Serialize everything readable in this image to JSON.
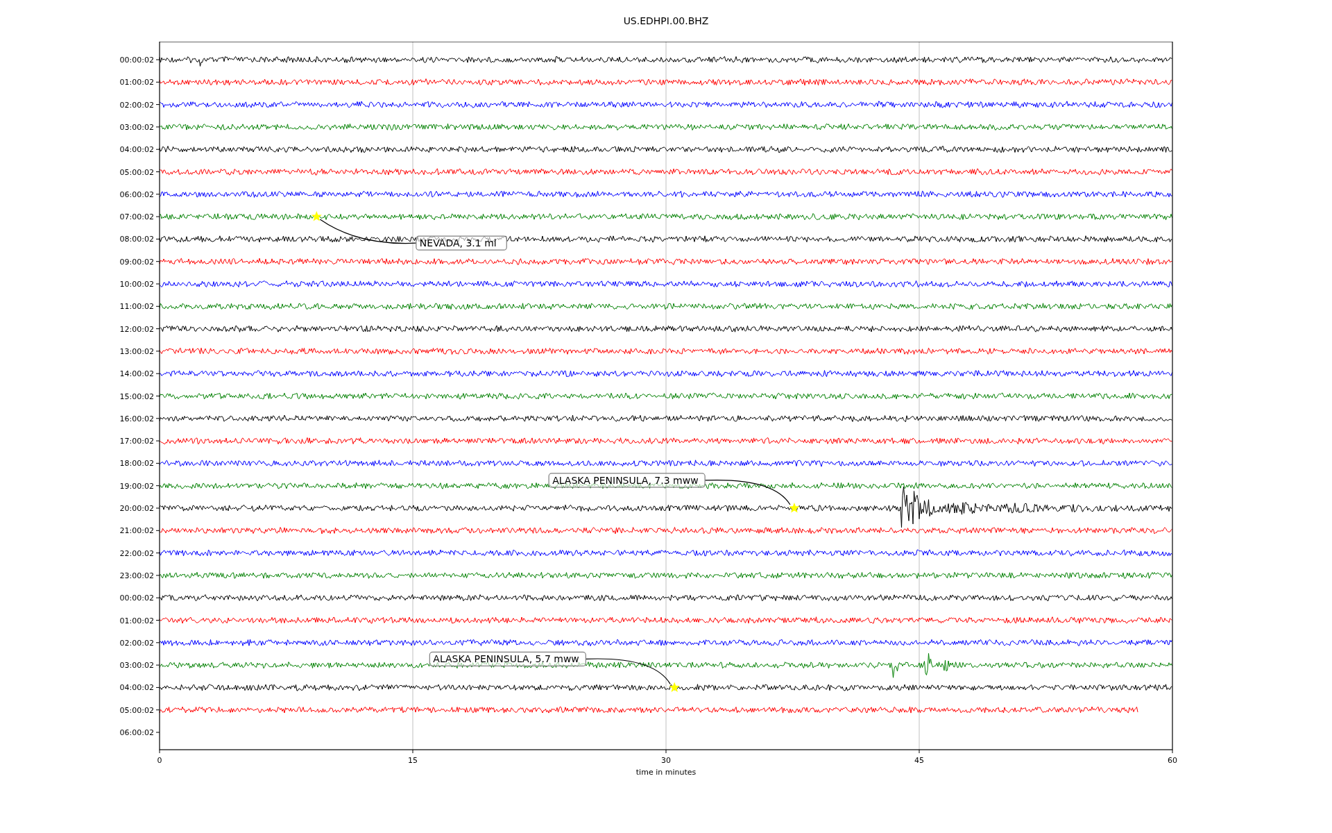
{
  "title": "US.EDHPI.00.BHZ",
  "rows": [
    {
      "label": "00:00:02",
      "kind": "full",
      "color": "#000000"
    },
    {
      "label": "01:00:02",
      "kind": "full",
      "color": "#ff0000"
    },
    {
      "label": "02:00:02",
      "kind": "full",
      "color": "#0000ff"
    },
    {
      "label": "03:00:02",
      "kind": "full",
      "color": "#008000"
    },
    {
      "label": "04:00:02",
      "kind": "full",
      "color": "#000000"
    },
    {
      "label": "05:00:02",
      "kind": "full",
      "color": "#ff0000"
    },
    {
      "label": "06:00:02",
      "kind": "full",
      "color": "#0000ff"
    },
    {
      "label": "07:00:02",
      "kind": "full",
      "color": "#008000",
      "event": {
        "label": "NEVADA, 3.1 ml"
      }
    },
    {
      "label": "08:00:02",
      "kind": "full",
      "color": "#000000"
    },
    {
      "label": "09:00:02",
      "kind": "full",
      "color": "#ff0000"
    },
    {
      "label": "10:00:02",
      "kind": "full",
      "color": "#0000ff"
    },
    {
      "label": "11:00:02",
      "kind": "full",
      "color": "#008000"
    },
    {
      "label": "12:00:02",
      "kind": "full",
      "color": "#000000"
    },
    {
      "label": "13:00:02",
      "kind": "full",
      "color": "#ff0000"
    },
    {
      "label": "14:00:02",
      "kind": "full",
      "color": "#0000ff"
    },
    {
      "label": "15:00:02",
      "kind": "full",
      "color": "#008000"
    },
    {
      "label": "16:00:02",
      "kind": "full",
      "color": "#000000"
    },
    {
      "label": "17:00:02",
      "kind": "full",
      "color": "#ff0000"
    },
    {
      "label": "18:00:02",
      "kind": "full",
      "color": "#0000ff"
    },
    {
      "label": "19:00:02",
      "kind": "full",
      "color": "#008000"
    },
    {
      "label": "20:00:02",
      "kind": "full",
      "color": "#000000",
      "event": {
        "label": "ALASKA PENINSULA, 7.3 mww"
      }
    },
    {
      "label": "21:00:02",
      "kind": "full",
      "color": "#ff0000"
    },
    {
      "label": "22:00:02",
      "kind": "full",
      "color": "#0000ff"
    },
    {
      "label": "23:00:02",
      "kind": "full",
      "color": "#008000"
    },
    {
      "label": "00:00:02",
      "kind": "full",
      "color": "#000000"
    },
    {
      "label": "01:00:02",
      "kind": "full",
      "color": "#ff0000"
    },
    {
      "label": "02:00:02",
      "kind": "full",
      "color": "#0000ff"
    },
    {
      "label": "03:00:02",
      "kind": "full",
      "color": "#008000"
    },
    {
      "label": "04:00:02",
      "kind": "full",
      "color": "#000000",
      "event": {
        "label": "ALASKA PENINSULA, 5.7 mww"
      }
    },
    {
      "label": "05:00:02",
      "kind": "partial",
      "color": "#ff0000"
    },
    {
      "label": "06:00:02",
      "kind": "none"
    }
  ],
  "x_axis": {
    "ticks": [
      "0",
      "15",
      "30",
      "45",
      "60"
    ],
    "label": "time in minutes"
  }
}
